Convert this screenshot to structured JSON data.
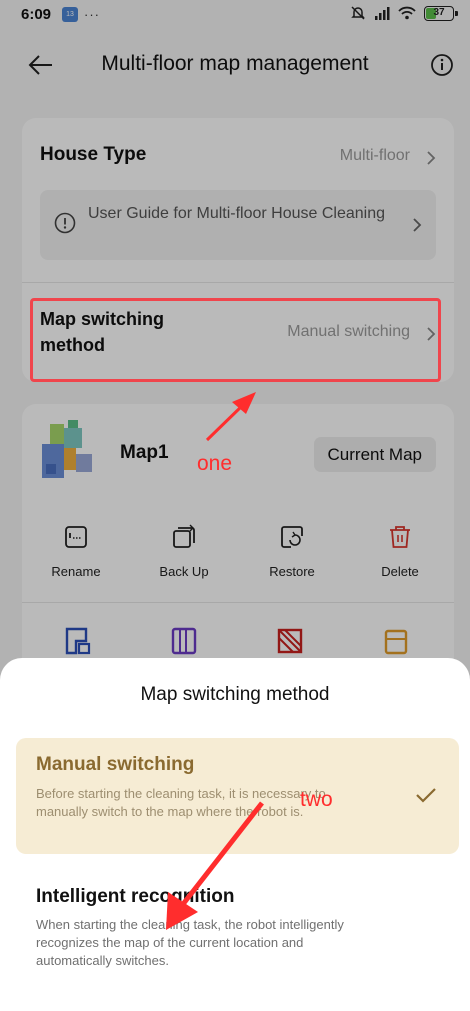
{
  "status_bar": {
    "time": "6:09",
    "notification_badge": "13",
    "more": "···",
    "battery": "37"
  },
  "header": {
    "title": "Multi-floor map management",
    "icons": [
      "back-arrow-icon",
      "info-icon"
    ]
  },
  "settings_card": {
    "house_type_label": "House Type",
    "house_type_value": "Multi-floor",
    "guide_text": "User Guide for Multi-floor House Cleaning",
    "switch_label": "Map switching method",
    "switch_value": "Manual switching"
  },
  "map_card": {
    "map_name": "Map1",
    "current_map_button": "Current Map",
    "actions": [
      {
        "label": "Rename",
        "icon": "rename-icon"
      },
      {
        "label": "Back Up",
        "icon": "backup-icon"
      },
      {
        "label": "Restore",
        "icon": "restore-icon"
      },
      {
        "label": "Delete",
        "icon": "delete-icon"
      }
    ],
    "colors": {
      "delete": "#d9362e",
      "tool_blue": "#2b4fb8",
      "tool_purple": "#6b3cc4",
      "tool_red": "#c8201e",
      "tool_orange": "#e09b2a"
    }
  },
  "annotations": {
    "one": "one",
    "two": "two",
    "color": "#ff2d2d"
  },
  "sheet": {
    "title": "Map switching method",
    "options": [
      {
        "title": "Manual switching",
        "description": "Before starting the cleaning task, it is necessary to manually switch to the map where the robot is.",
        "selected": true
      },
      {
        "title": "Intelligent recognition",
        "description": "When starting the cleaning task, the robot intelligently recognizes the map of the current location and automatically switches.",
        "selected": false
      }
    ],
    "accent_color": "#8a6a30",
    "selected_bg": "#f6ecd4"
  }
}
